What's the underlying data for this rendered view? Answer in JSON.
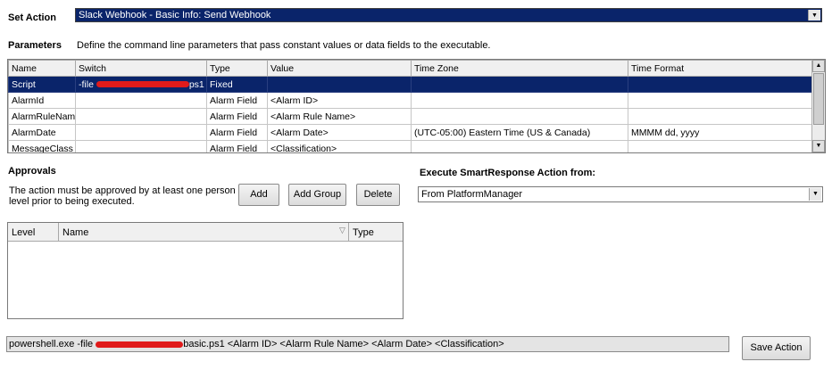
{
  "set_action": {
    "label": "Set Action",
    "value": "Slack Webhook - Basic Info: Send Webhook"
  },
  "parameters": {
    "label": "Parameters",
    "description": "Define the command line parameters that pass constant values or data fields to the executable.",
    "columns": [
      "Name",
      "Switch",
      "Type",
      "Value",
      "Time Zone",
      "Time Format"
    ],
    "rows": [
      {
        "name": "Script",
        "switch_prefix": "-file",
        "switch_suffix": "ps1",
        "type": "Fixed",
        "value": "",
        "tz": "",
        "fmt": ""
      },
      {
        "name": "AlarmId",
        "switch_prefix": "",
        "switch_suffix": "",
        "type": "Alarm Field",
        "value": "<Alarm ID>",
        "tz": "",
        "fmt": ""
      },
      {
        "name": "AlarmRuleName",
        "switch_prefix": "",
        "switch_suffix": "",
        "type": "Alarm Field",
        "value": "<Alarm Rule Name>",
        "tz": "",
        "fmt": ""
      },
      {
        "name": "AlarmDate",
        "switch_prefix": "",
        "switch_suffix": "",
        "type": "Alarm Field",
        "value": "<Alarm Date>",
        "tz": "(UTC-05:00) Eastern Time (US & Canada)",
        "fmt": "MMMM dd, yyyy"
      },
      {
        "name": "MessageClass",
        "switch_prefix": "",
        "switch_suffix": "",
        "type": "Alarm Field",
        "value": "<Classification>",
        "tz": "",
        "fmt": ""
      }
    ]
  },
  "approvals": {
    "label": "Approvals",
    "description_line1": "The action must be approved by at least one person in each",
    "description_line2": "level prior to being executed.",
    "add": "Add",
    "add_group": "Add Group",
    "delete": "Delete",
    "columns": [
      "Level",
      "Name",
      "Type"
    ]
  },
  "execute": {
    "label": "Execute SmartResponse Action from:",
    "value": "From PlatformManager"
  },
  "command": {
    "prefix": "powershell.exe -file",
    "suffix": "basic.ps1  <Alarm ID>  <Alarm Rule Name>  <Alarm Date>  <Classification>"
  },
  "save": "Save Action"
}
